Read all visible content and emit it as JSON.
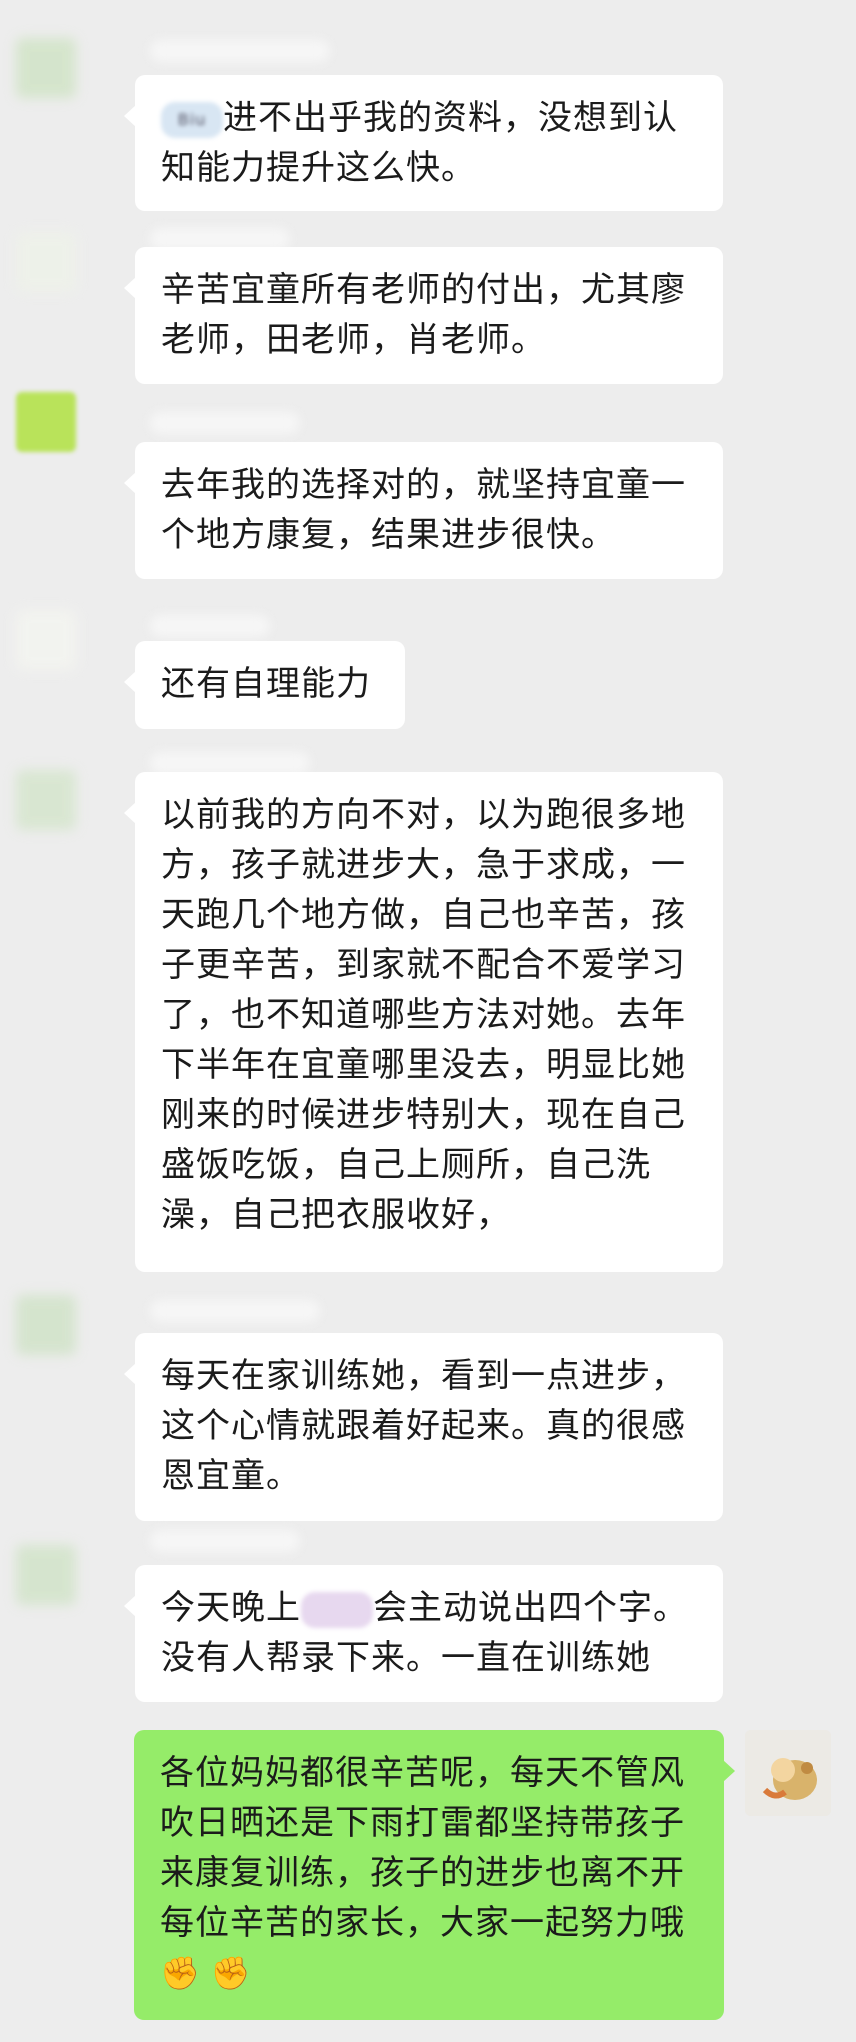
{
  "messages": [
    {
      "text": "进不出乎我的资料，没想到认知能力提升这么快。",
      "redacted_prefix": "Biu"
    },
    {
      "text": "辛苦宜童所有老师的付出，尤其廖老师，田老师，肖老师。"
    },
    {
      "text": "去年我的选择对的，就坚持宜童一个地方康复，结果进步很快。"
    },
    {
      "text": "还有自理能力"
    },
    {
      "text": "以前我的方向不对，以为跑很多地方，孩子就进步大，急于求成，一天跑几个地方做，自己也辛苦，孩子更辛苦，到家就不配合不爱学习了，也不知道哪些方法对她。去年下半年在宜童哪里没去，明显比她刚来的时候进步特别大，现在自己盛饭吃饭，自己上厕所，自己洗澡，自己把衣服收好，"
    },
    {
      "text": "每天在家训练她，看到一点进步，这个心情就跟着好起来。真的很感恩宜童。"
    },
    {
      "text_before": "今天晚上",
      "text_after": "会主动说出四个字。没有人帮录下来。一直在训练她"
    },
    {
      "text": "各位妈妈都很辛苦呢，每天不管风吹日晒还是下雨打雷都坚持带孩子来康复训练，孩子的进步也离不开每位辛苦的家长，大家一起努力哦",
      "emoji": [
        "✊",
        "✊"
      ]
    }
  ]
}
